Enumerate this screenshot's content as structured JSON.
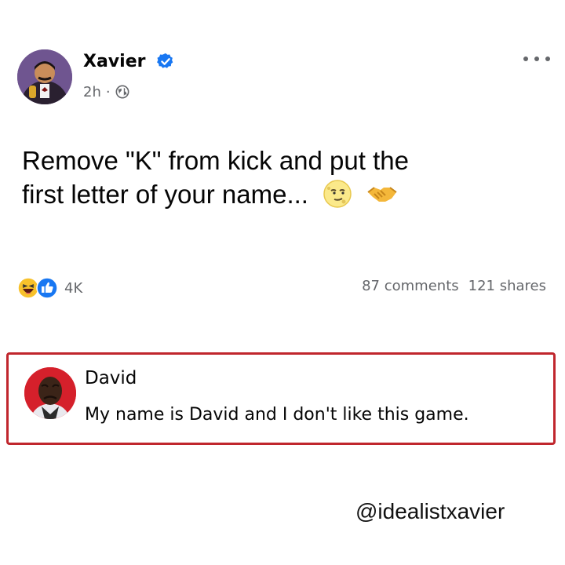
{
  "post": {
    "author": "Xavier",
    "time": "2h",
    "separator": "·",
    "text_line1": "Remove \"K\" from kick and put the",
    "text_line2": "first letter of your name...",
    "emojis": [
      "moon-face-emoji",
      "handshake-emoji"
    ],
    "verified_color": "#1877f2"
  },
  "reactions": {
    "icons": [
      "laughing-reaction-icon",
      "like-reaction-icon"
    ],
    "count": "4K",
    "comments": "87 comments",
    "shares": "121 shares"
  },
  "comment": {
    "author": "David",
    "text": "My name is David and I don't like this game.",
    "highlight_color": "#c0262d"
  },
  "watermark": "@idealistxavier"
}
